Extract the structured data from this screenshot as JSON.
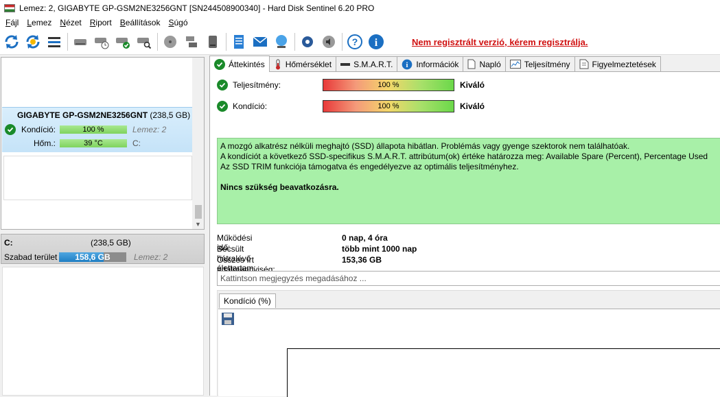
{
  "window": {
    "title": "Lemez: 2, GIGABYTE GP-GSM2NE3256GNT [SN244508900340]  -  Hard Disk Sentinel 6.20 PRO"
  },
  "menu": {
    "items": [
      {
        "pre": "",
        "u": "F",
        "post": "ájl"
      },
      {
        "pre": "",
        "u": "L",
        "post": "emez"
      },
      {
        "pre": "",
        "u": "N",
        "post": "ézet"
      },
      {
        "pre": "",
        "u": "R",
        "post": "iport"
      },
      {
        "pre": "",
        "u": "B",
        "post": "eállítások"
      },
      {
        "pre": "",
        "u": "S",
        "post": "úgó"
      }
    ]
  },
  "toolbar": {
    "register_text": "Nem regisztrált verzió, kérem regisztrálja."
  },
  "disk": {
    "name": "GIGABYTE GP-GSM2NE3256GNT",
    "size": "(238,5 GB)",
    "condition_label": "Kondíció:",
    "condition_value": "100 %",
    "condition_extra": "Lemez: 2",
    "temp_label": "Hőm.:",
    "temp_value": "39 °C",
    "temp_extra": "C:"
  },
  "partition": {
    "letter": "C:",
    "size": "(238,5 GB)",
    "free_label": "Szabad terület",
    "free_value": "158,6 GB",
    "free_fraction": 0.665,
    "extra": "Lemez: 2"
  },
  "tabs": [
    {
      "label": "Áttekintés",
      "icon": "check-icon"
    },
    {
      "label": "Hőmérséklet",
      "icon": "thermometer-icon"
    },
    {
      "label": "S.M.A.R.T.",
      "icon": "smart-icon"
    },
    {
      "label": "Információk",
      "icon": "info-icon"
    },
    {
      "label": "Napló",
      "icon": "log-icon"
    },
    {
      "label": "Teljesítmény",
      "icon": "chart-icon"
    },
    {
      "label": "Figyelmeztetések",
      "icon": "alert-icon"
    }
  ],
  "overview": {
    "performance_label": "Teljesítmény:",
    "performance_value": "100 %",
    "performance_verdict": "Kiváló",
    "condition_label": "Kondíció:",
    "condition_value": "100 %",
    "condition_verdict": "Kiváló",
    "message_lines": [
      "A mozgó alkatrész nélküli meghajtó (SSD) állapota hibátlan. Problémás vagy gyenge szektorok nem találhatóak.",
      "A kondíciót a következő SSD-specifikus S.M.A.R.T. attribútum(ok) értéke határozza meg:  Available Spare (Percent), Percentage Used",
      "Az SSD TRIM funkciója támogatva és engedélyezve az optimális teljesítményhez."
    ],
    "message_bold": "Nincs szükség beavatkozásra.",
    "uptime_label": "Működési idő:",
    "uptime_value": "0 nap, 4 óra",
    "lifetime_label": "Becsült hátralévő élettartam:",
    "lifetime_value": "több mint 1000 nap",
    "written_label": "Összes írt adatmennyiség:",
    "written_value": "153,36 GB",
    "comment_placeholder": "Kattintson megjegyzés megadásához ...",
    "chart_tab_label": "Kondíció  (%)"
  }
}
